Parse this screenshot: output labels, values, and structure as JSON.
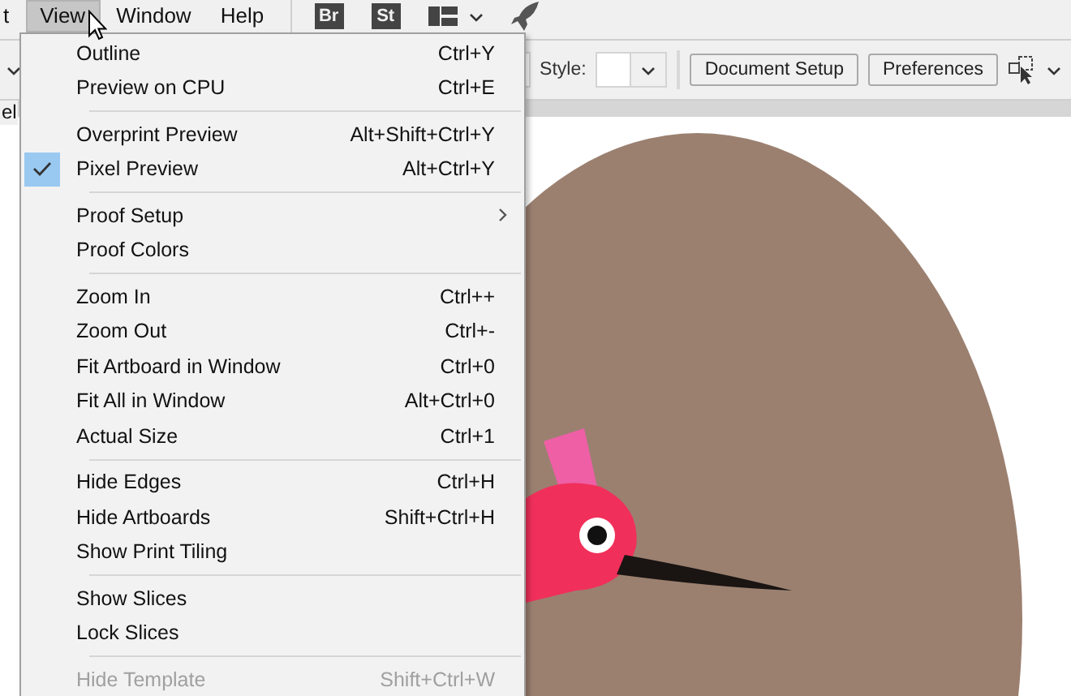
{
  "menu_bar": {
    "items": [
      {
        "label": "t",
        "selected": false
      },
      {
        "label": "View",
        "selected": true
      },
      {
        "label": "Window",
        "selected": false
      },
      {
        "label": "Help",
        "selected": false
      }
    ],
    "app_badges": [
      "Br",
      "St"
    ]
  },
  "control_bar": {
    "style_label": "Style:",
    "buttons": [
      "Document Setup",
      "Preferences"
    ]
  },
  "document_tab": {
    "label": "el"
  },
  "view_menu": {
    "groups": [
      [
        {
          "label": "Outline",
          "shortcut": "Ctrl+Y",
          "checked": false,
          "disabled": false
        },
        {
          "label": "Preview on CPU",
          "shortcut": "Ctrl+E",
          "checked": false,
          "disabled": false
        }
      ],
      [
        {
          "label": "Overprint Preview",
          "shortcut": "Alt+Shift+Ctrl+Y",
          "checked": false,
          "disabled": false
        },
        {
          "label": "Pixel Preview",
          "shortcut": "Alt+Ctrl+Y",
          "checked": true,
          "disabled": false
        }
      ],
      [
        {
          "label": "Proof Setup",
          "submenu": true,
          "checked": false,
          "disabled": false
        },
        {
          "label": "Proof Colors",
          "checked": false,
          "disabled": false
        }
      ],
      [
        {
          "label": "Zoom In",
          "shortcut": "Ctrl++",
          "checked": false,
          "disabled": false
        },
        {
          "label": "Zoom Out",
          "shortcut": "Ctrl+-",
          "checked": false,
          "disabled": false
        },
        {
          "label": "Fit Artboard in Window",
          "shortcut": "Ctrl+0",
          "checked": false,
          "disabled": false
        },
        {
          "label": "Fit All in Window",
          "shortcut": "Alt+Ctrl+0",
          "checked": false,
          "disabled": false
        },
        {
          "label": "Actual Size",
          "shortcut": "Ctrl+1",
          "checked": false,
          "disabled": false
        }
      ],
      [
        {
          "label": "Hide Edges",
          "shortcut": "Ctrl+H",
          "checked": false,
          "disabled": false
        },
        {
          "label": "Hide Artboards",
          "shortcut": "Shift+Ctrl+H",
          "checked": false,
          "disabled": false
        },
        {
          "label": "Show Print Tiling",
          "checked": false,
          "disabled": false
        }
      ],
      [
        {
          "label": "Show Slices",
          "checked": false,
          "disabled": false
        },
        {
          "label": "Lock Slices",
          "checked": false,
          "disabled": false
        }
      ],
      [
        {
          "label": "Hide Template",
          "shortcut": "Shift+Ctrl+W",
          "checked": false,
          "disabled": true
        }
      ]
    ]
  }
}
